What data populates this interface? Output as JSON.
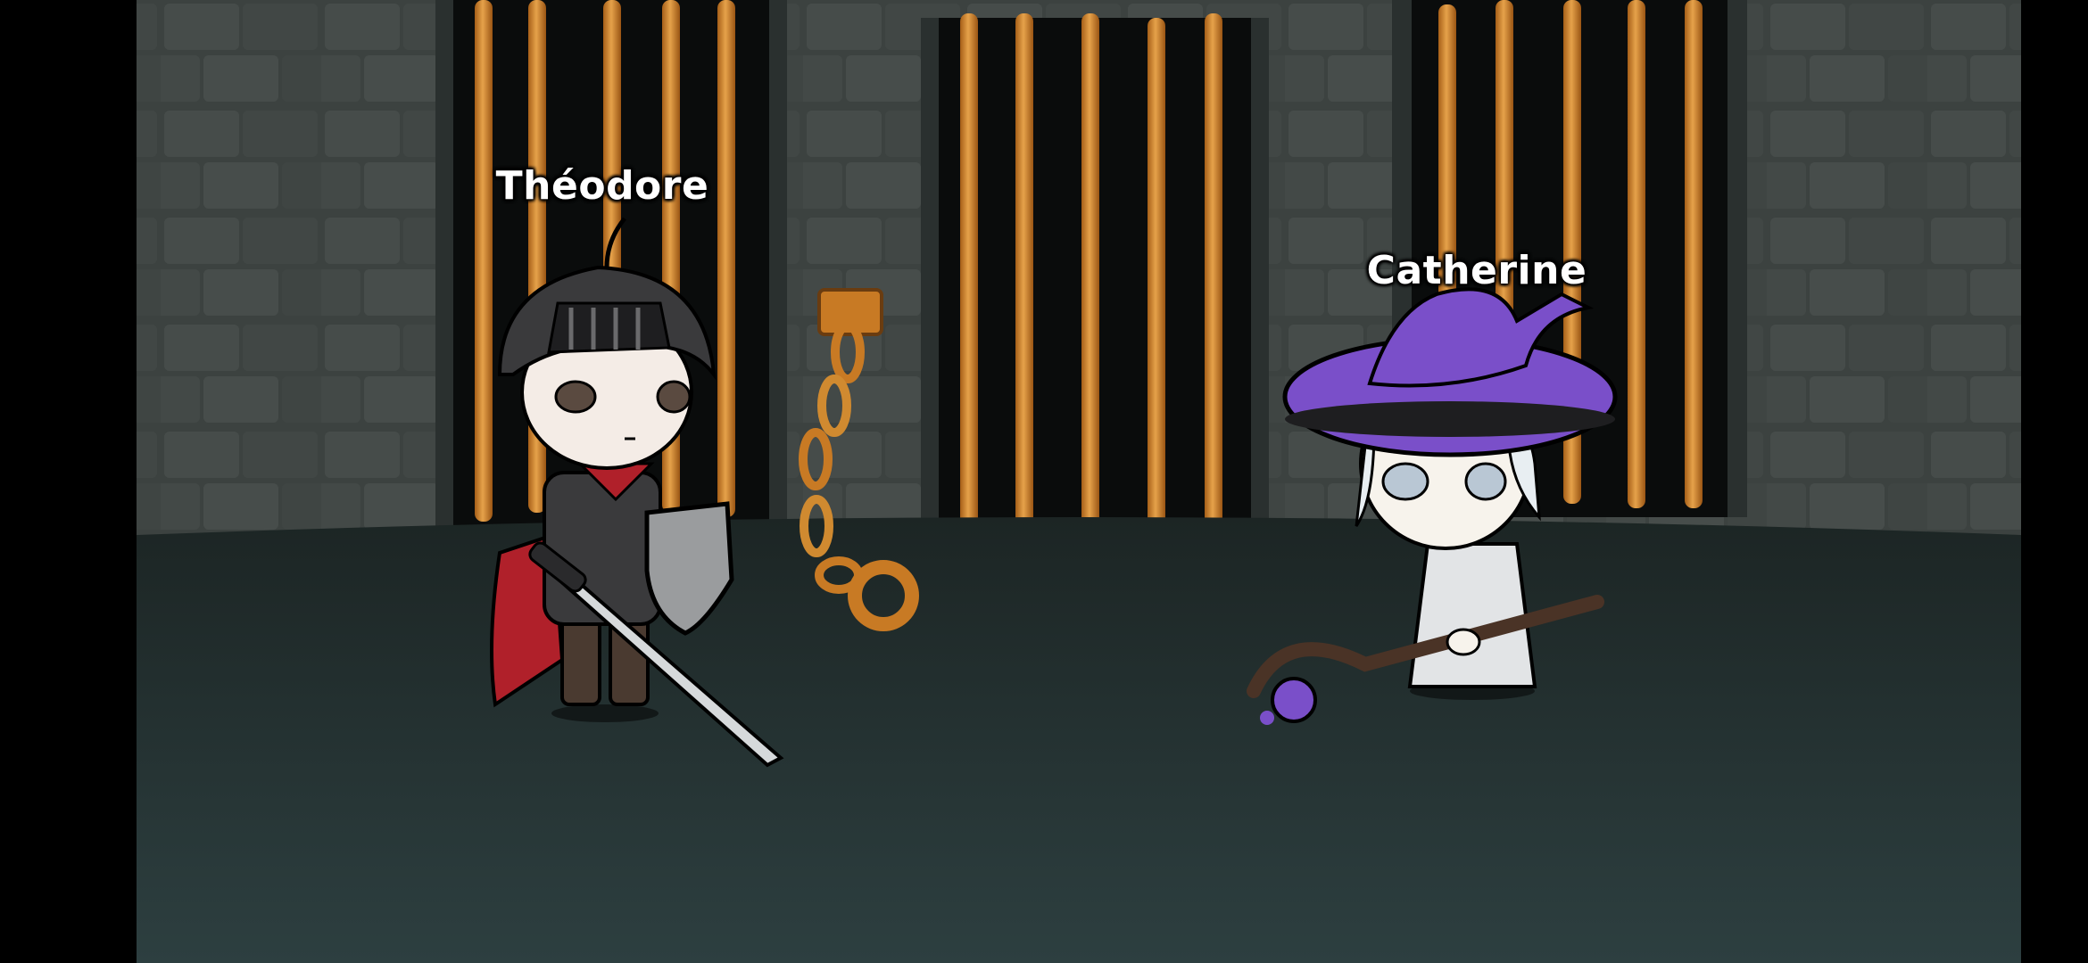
{
  "scene": {
    "setting": "dungeon-cell",
    "colors": {
      "letterbox": "#000000",
      "wall": "#3c4240",
      "wall_mortar": "#2a2f2e",
      "floor_top": "#1e2827",
      "floor_bottom": "#2c3d3d",
      "bars": "#c87a24",
      "bars_highlight": "#e6a24a"
    }
  },
  "characters": [
    {
      "name": "Théodore",
      "role": "knight",
      "colors": {
        "hair": "#3a3a3c",
        "cape": "#b0202a",
        "armor": "#3a3a3c",
        "shield": "#9a9c9e",
        "scarf": "#b0202a"
      }
    },
    {
      "name": "Catherine",
      "role": "witch",
      "colors": {
        "hat": "#7a4fc9",
        "hair": "#e8eef2",
        "dress": "#e2e4e6",
        "staff": "#4a3326",
        "orb": "#7a4fc9"
      }
    }
  ],
  "props": [
    "wall-chain-shackle-icon",
    "prison-bars-icon"
  ]
}
